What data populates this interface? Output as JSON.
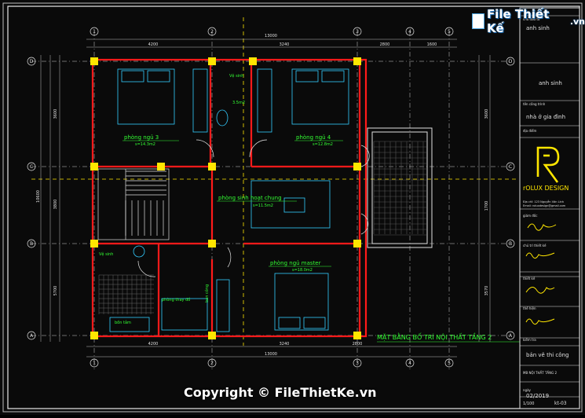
{
  "watermark": {
    "logo_text": "File Thiết Kế",
    "logo_suffix": ".vn",
    "copyright": "Copyright © FileThietKe.vn"
  },
  "plan": {
    "title": "MẶT BẰNG BỐ TRÍ NỘI THẤT TẦNG 2",
    "grid_cols": [
      "1",
      "2",
      "3",
      "4",
      "5"
    ],
    "grid_rows": [
      "D",
      "C",
      "B",
      "A"
    ],
    "dims_top": [
      "13000",
      "4200",
      "3240",
      "2800",
      "1600"
    ],
    "dims_bottom": [
      "4200",
      "3240",
      "2800",
      "13000"
    ],
    "dims_left": [
      "3600",
      "3800",
      "5700",
      "10600"
    ],
    "dims_right": [
      "3600",
      "1700",
      "3570"
    ],
    "rooms": {
      "bed3_name": "phòng ngủ 3",
      "bed3_area": "s=14.3m2",
      "bed4_name": "phòng ngủ 4",
      "bed4_area": "s=12.8m2",
      "wc_top": "Vệ sinh",
      "wc_top_area": "3.5m2",
      "living_name": "phòng sinh hoạt chung",
      "living_area": "s=11.5m2",
      "master_name": "phòng ngủ master",
      "master_area": "s=18.0m2",
      "wc_left": "Vệ sinh",
      "wc_left_area": "5.6m2",
      "dressing": "phòng thay đồ",
      "bath": "bồn tắm",
      "balcony": "ban công"
    }
  },
  "titleblock": {
    "company_label": "chủ đầu tư",
    "owner": "anh sinh",
    "project_label": "tên công trình",
    "project": "nhà ở gia đình",
    "address_label": "địa điểm",
    "brand": "rOLUX DESIGN",
    "brand_line1": "Địa chỉ: 123 Nguyễn Văn Linh",
    "brand_line2": "Email: roluxdesign@gmail.com",
    "director_label": "giám đốc",
    "architect_label": "chủ trì thiết kế",
    "designer_label": "thiết kế",
    "drawn_label": "thể hiện",
    "checker_label": "kiểm tra",
    "sheet_label": "bản vẽ thi công",
    "sheet_title": "MB NỘI THẤT TẦNG 2",
    "date_label": "ngày",
    "date": "02/2019",
    "scale": "1/100",
    "sheet_no": "kt-03"
  },
  "colors": {
    "wall": "#ff1a1a",
    "column": "#ffe600",
    "grid": "#e0e0e0",
    "text": "#33ff33",
    "cyan": "#33ccff",
    "frame": "#ffffff"
  }
}
